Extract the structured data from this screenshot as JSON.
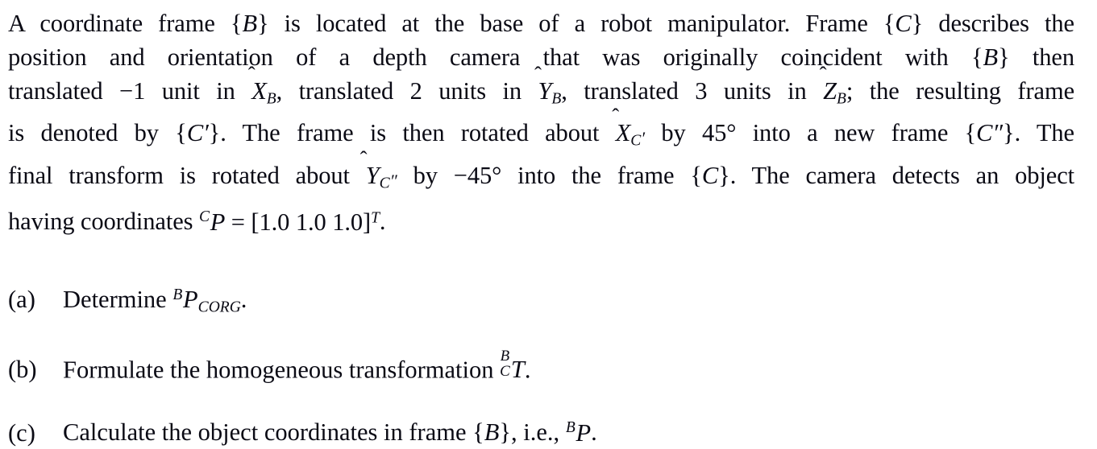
{
  "document": {
    "type": "textbook-problem",
    "subject": "robotics-coordinate-frames",
    "background_color": "#ffffff",
    "text_color": "#0a0a14"
  },
  "problem": {
    "lines": [
      {
        "id": "line-1",
        "segments": [
          {
            "t": "text",
            "v": "A coordinate frame "
          },
          {
            "t": "frame",
            "v": "{B}"
          },
          {
            "t": "text",
            "v": " is located at the base of a robot manipulator. Frame "
          },
          {
            "t": "frame",
            "v": "{C}"
          },
          {
            "t": "text",
            "v": " describes the"
          }
        ]
      },
      {
        "id": "line-2",
        "segments": [
          {
            "t": "text",
            "v": "position and orientation of a depth camera that was originally coincident with "
          },
          {
            "t": "frame",
            "v": "{B}"
          },
          {
            "t": "text",
            "v": " then"
          }
        ]
      },
      {
        "id": "line-3",
        "segments": [
          {
            "t": "text",
            "v": "translated −1 unit in "
          },
          {
            "t": "hatvar",
            "v": "X",
            "sub": "B"
          },
          {
            "t": "text",
            "v": ", translated 2 units in "
          },
          {
            "t": "hatvar",
            "v": "Y",
            "sub": "B"
          },
          {
            "t": "text",
            "v": ", translated 3 units in "
          },
          {
            "t": "hatvar",
            "v": "Z",
            "sub": "B"
          },
          {
            "t": "text",
            "v": "; the resulting frame"
          }
        ]
      },
      {
        "id": "line-4",
        "segments": [
          {
            "t": "text",
            "v": "is denoted by "
          },
          {
            "t": "frame",
            "v": "{C′}"
          },
          {
            "t": "text",
            "v": ". The frame is then rotated about "
          },
          {
            "t": "hatvar",
            "v": "X",
            "sub": "C",
            "prime": "′"
          },
          {
            "t": "text",
            "v": " by 45° into a new frame "
          },
          {
            "t": "frame",
            "v": "{C″}"
          },
          {
            "t": "text",
            "v": ". The"
          }
        ]
      },
      {
        "id": "line-5",
        "segments": [
          {
            "t": "text",
            "v": "final transform is rotated about "
          },
          {
            "t": "hatvar",
            "v": "Y",
            "sub": "C",
            "prime": "″"
          },
          {
            "t": "text",
            "v": " by −45° into the frame "
          },
          {
            "t": "frame",
            "v": "{C}"
          },
          {
            "t": "text",
            "v": ". The camera detects an object"
          }
        ]
      },
      {
        "id": "line-6",
        "segments": [
          {
            "t": "text",
            "v": "having coordinates "
          },
          {
            "t": "presup",
            "v": "C"
          },
          {
            "t": "mi",
            "v": "P"
          },
          {
            "t": "text",
            "v": " = [1.0 1.0 1.0]"
          },
          {
            "t": "sup",
            "v": "T"
          },
          {
            "t": "text",
            "v": "."
          }
        ]
      }
    ],
    "plain_text": "A coordinate frame {B} is located at the base of a robot manipulator. Frame {C} describes the position and orientation of a depth camera that was originally coincident with {B} then translated −1 unit in X̂_B, translated 2 units in Ŷ_B, translated 3 units in Ẑ_B; the resulting frame is denoted by {C′}. The frame is then rotated about X̂_{C′} by 45° into a new frame {C″}. The final transform is rotated about Ŷ_{C″} by −45° into the frame {C}. The camera detects an object having coordinates ᶜP = [1.0 1.0 1.0]ᵀ.",
    "values": {
      "translation_x": "−1",
      "translation_y": "2",
      "translation_z": "3",
      "rotation_x_angle": "45°",
      "rotation_y_angle": "−45°",
      "point_in_C": [
        "1.0",
        "1.0",
        "1.0"
      ]
    }
  },
  "items": [
    {
      "id": "item-a",
      "marker": "(a)",
      "prefix": "Determine ",
      "presup": "B",
      "symbol": "P",
      "subscript": "CORG",
      "suffix": ".",
      "plain": "Determine ᴮP_CORG."
    },
    {
      "id": "item-b",
      "marker": "(b)",
      "prefix": "Formulate the homogeneous transformation ",
      "prescript_top": "B",
      "prescript_bottom": "C",
      "symbol": "T",
      "suffix": ".",
      "plain": "Formulate the homogeneous transformation ᴮ_C T."
    },
    {
      "id": "item-c",
      "marker": "(c)",
      "prefix": "Calculate the object coordinates in frame ",
      "frame": "{B}",
      "middle": ", i.e., ",
      "presup": "B",
      "symbol": "P",
      "suffix": ".",
      "plain": "Calculate the object coordinates in frame {B}, i.e., ᴮP."
    }
  ]
}
